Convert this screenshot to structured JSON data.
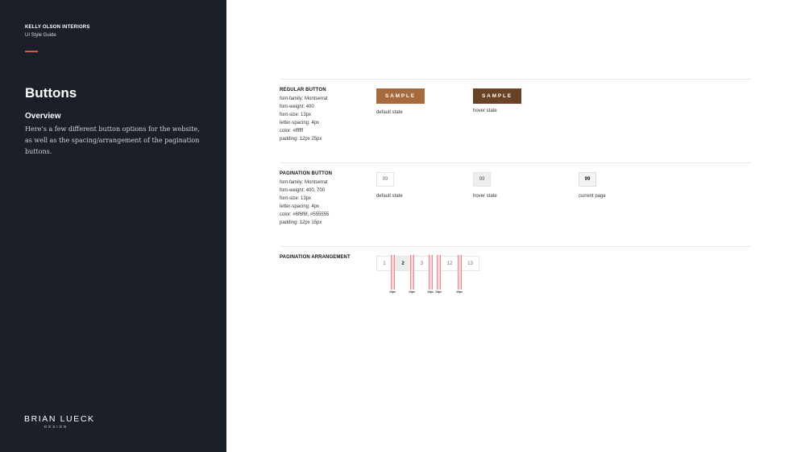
{
  "sidebar": {
    "brand": "KELLY OLSON INTERIORS",
    "brand_sub": "UI Style Guide",
    "section_title": "Buttons",
    "overview_heading": "Overview",
    "overview_text": "Here’s a few different button options for the website, as well as the spacing/arrangement of the pagination buttons.",
    "logo_main": "BRIAN LUECK",
    "logo_sub": "DESIGN",
    "accent_color": "#c95a4c",
    "background_color": "#1b2028"
  },
  "regular_button": {
    "title": "REGULAR BUTTON",
    "specs": [
      "font-family: Montserrat",
      "font-weight: 400",
      "font-size: 13px",
      "letter-spacing: 4px",
      "color: #ffffff",
      "padding: 12px 25px"
    ],
    "sample_label": "SAMPLE",
    "default_label": "default state",
    "hover_label": "hover state",
    "default_color": "#a66a3c",
    "hover_color": "#6a4326"
  },
  "pagination_button": {
    "title": "PAGINATION BUTTON",
    "specs": [
      "font-family: Montserrat",
      "font-weight: 400, 700",
      "font-size: 13px",
      "letter-spacing: 4px",
      "color: #6f6f6f, #555555",
      "padding: 12px 15px"
    ],
    "sample_value": "99",
    "default_label": "default state",
    "hover_label": "hover state",
    "current_label": "current page"
  },
  "pagination_arrangement": {
    "title": "PAGINATION ARRANGEMENT",
    "pages": [
      "1",
      "2",
      "3",
      "12",
      "13"
    ],
    "active_page": "2",
    "gap_labels": [
      "10px",
      "10px",
      "10px",
      "10px",
      "10px"
    ]
  }
}
